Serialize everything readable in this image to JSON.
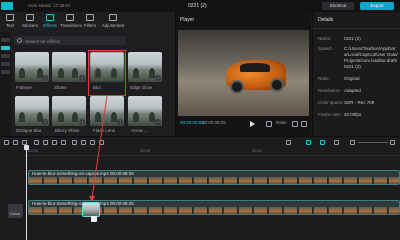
{
  "topbar": {
    "autosave": "Auto saved: 17:35:57",
    "title": "0221 (2)",
    "shortcut_label": "Shortcut",
    "export_label": "Export"
  },
  "tabs": [
    {
      "label": "Text"
    },
    {
      "label": "Stickers"
    },
    {
      "label": "Effects",
      "active": true
    },
    {
      "label": "Transitions"
    },
    {
      "label": "Filters"
    },
    {
      "label": "Adjustment"
    }
  ],
  "search": {
    "placeholder": "Search for effects"
  },
  "effects": [
    {
      "label": "Fisheye"
    },
    {
      "label": "Shake"
    },
    {
      "label": "Blur"
    },
    {
      "label": "Edge Glow"
    },
    {
      "label": "Distique Blur"
    },
    {
      "label": "Blurry Shine"
    },
    {
      "label": "Flash Lens"
    },
    {
      "label": "Arrow ..."
    }
  ],
  "player": {
    "title": "Player",
    "current_time": "00:00:00:00",
    "duration": "00:00:08:25",
    "ratio": "Ratio"
  },
  "details": {
    "title": "Details",
    "fields": [
      {
        "key": "Name:",
        "value": "0221 (2)"
      },
      {
        "key": "Saved:",
        "value": "C:/Users/Tourbos/AppData/Local/CapCut/User Data/Projects/com.lveditor.draft/0221 (2)"
      },
      {
        "key": "Ratio:",
        "value": "Original"
      },
      {
        "key": "Resolution:",
        "value": "Adapted"
      },
      {
        "key": "Color space:",
        "value": "SDR - Rec.709"
      },
      {
        "key": "Frame rate:",
        "value": "30.00fps"
      }
    ]
  },
  "timeline": {
    "ruler": [
      "00:00",
      "00:05",
      "00:10"
    ],
    "track1_label": "How-to-blur-something-on-capcut.mp4  00:00:08:25",
    "track2_label": "How-to-blur-something-on-capcut.mp4  00:00:08:25",
    "cover_label": "Cover"
  }
}
